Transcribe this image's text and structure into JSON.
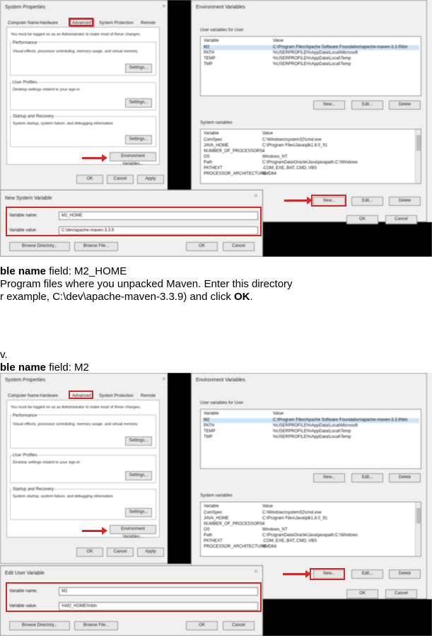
{
  "shot1": {
    "sysprops": {
      "title": "System Properties",
      "tabs": [
        "Computer Name",
        "Hardware",
        "Advanced",
        "System Protection",
        "Remote"
      ],
      "admin_note": "You must be logged on as an Administrator to make most of these changes.",
      "perf_title": "Performance",
      "perf_desc": "Visual effects, processor scheduling, memory usage, and virtual memory",
      "perf_btn": "Settings...",
      "profiles_title": "User Profiles",
      "profiles_desc": "Desktop settings related to your sign-in",
      "profiles_btn": "Settings...",
      "startup_title": "Startup and Recovery",
      "startup_desc": "System startup, system failure, and debugging information",
      "startup_btn": "Settings...",
      "envvars_btn": "Environment Variables...",
      "ok": "OK",
      "cancel": "Cancel",
      "apply": "Apply"
    },
    "envvars": {
      "title": "Environment Variables",
      "user_group": "User variables for User",
      "user_header": [
        "Variable",
        "Value"
      ],
      "user_rows": [
        [
          "M2",
          "C:\\Program Files\\Apache Software Foundation\\apache-maven-3.3.9\\bin"
        ],
        [
          "PATH",
          "%USERPROFILE%\\AppData\\Local\\Microsoft"
        ],
        [
          "TEMP",
          "%USERPROFILE%\\AppData\\Local\\Temp"
        ],
        [
          "TMP",
          "%USERPROFILE%\\AppData\\Local\\Temp"
        ]
      ],
      "user_new": "New...",
      "user_edit": "Edit...",
      "user_delete": "Delete",
      "sys_group": "System variables",
      "sys_header": [
        "Variable",
        "Value"
      ],
      "sys_rows": [
        [
          "ComSpec",
          "C:\\Windows\\system32\\cmd.exe"
        ],
        [
          "JAVA_HOME",
          "C:\\Program Files\\Java\\jdk1.8.0_91"
        ],
        [
          "NUMBER_OF_PROCESSORS",
          "4"
        ],
        [
          "OS",
          "Windows_NT"
        ],
        [
          "Path",
          "C:\\ProgramData\\Oracle\\Java\\javapath;C:\\Windows"
        ],
        [
          "PATHEXT",
          ".COM;.EXE;.BAT;.CMD;.VBS"
        ],
        [
          "PROCESSOR_ARCHITECTURE",
          "AMD64"
        ]
      ],
      "sys_new": "New...",
      "sys_edit": "Edit...",
      "sys_delete": "Delete",
      "ok": "OK",
      "cancel": "Cancel"
    },
    "newvar": {
      "title": "New System Variable",
      "name_label": "Variable name:",
      "name_value": "M2_HOME",
      "value_label": "Variable value:",
      "value_value": "C:\\dev\\apache-maven-3.3.9",
      "browse_dir": "Browse Directory...",
      "browse_file": "Browse File...",
      "ok": "OK",
      "cancel": "Cancel"
    }
  },
  "instructions": {
    "line1_bold": "ble name",
    "line1_rest": " field: M2_HOME",
    "line2": " Program files where you unpacked Maven. Enter this directory",
    "line3_pre": "r example, C:\\dev\\apache-maven-3.3.9) and click ",
    "line3_bold": "OK",
    "line3_post": ".",
    "line4": "v.",
    "line5_bold": "ble name",
    "line5_rest": " field: M2"
  },
  "shot2": {
    "sysprops": {
      "title": "System Properties",
      "tabs": [
        "Computer Name",
        "Hardware",
        "Advanced",
        "System Protection",
        "Remote"
      ],
      "admin_note": "You must be logged on as an Administrator to make most of these changes.",
      "perf_title": "Performance",
      "perf_desc": "Visual effects, processor scheduling, memory usage, and virtual memory",
      "perf_btn": "Settings...",
      "profiles_title": "User Profiles",
      "profiles_desc": "Desktop settings related to your sign-in",
      "profiles_btn": "Settings...",
      "startup_title": "Startup and Recovery",
      "startup_desc": "System startup, system failure, and debugging information",
      "startup_btn": "Settings...",
      "envvars_btn": "Environment Variables...",
      "ok": "OK",
      "cancel": "Cancel",
      "apply": "Apply"
    },
    "envvars": {
      "title": "Environment Variables",
      "user_group": "User variables for User",
      "user_header": [
        "Variable",
        "Value"
      ],
      "user_rows": [
        [
          "M2",
          "C:\\Program Files\\Apache Software Foundation\\apache-maven-3.3.9\\bin"
        ],
        [
          "PATH",
          "%USERPROFILE%\\AppData\\Local\\Microsoft"
        ],
        [
          "TEMP",
          "%USERPROFILE%\\AppData\\Local\\Temp"
        ],
        [
          "TMP",
          "%USERPROFILE%\\AppData\\Local\\Temp"
        ]
      ],
      "user_new": "New...",
      "user_edit": "Edit...",
      "user_delete": "Delete",
      "sys_group": "System variables",
      "sys_header": [
        "Variable",
        "Value"
      ],
      "sys_rows": [
        [
          "ComSpec",
          "C:\\Windows\\system32\\cmd.exe"
        ],
        [
          "JAVA_HOME",
          "C:\\Program Files\\Java\\jdk1.8.0_91"
        ],
        [
          "NUMBER_OF_PROCESSORS",
          "4"
        ],
        [
          "OS",
          "Windows_NT"
        ],
        [
          "Path",
          "C:\\ProgramData\\Oracle\\Java\\javapath;C:\\Windows"
        ],
        [
          "PATHEXT",
          ".COM;.EXE;.BAT;.CMD;.VBS"
        ],
        [
          "PROCESSOR_ARCHITECTURE",
          "AMD64"
        ]
      ],
      "sys_new": "New...",
      "sys_edit": "Edit...",
      "sys_delete": "Delete",
      "ok": "OK",
      "cancel": "Cancel"
    },
    "newvar": {
      "title": "Edit User Variable",
      "name_label": "Variable name:",
      "name_value": "M2",
      "value_label": "Variable value:",
      "value_value": "%M2_HOME%\\bin",
      "browse_dir": "Browse Directory...",
      "browse_file": "Browse File...",
      "ok": "OK",
      "cancel": "Cancel"
    }
  }
}
